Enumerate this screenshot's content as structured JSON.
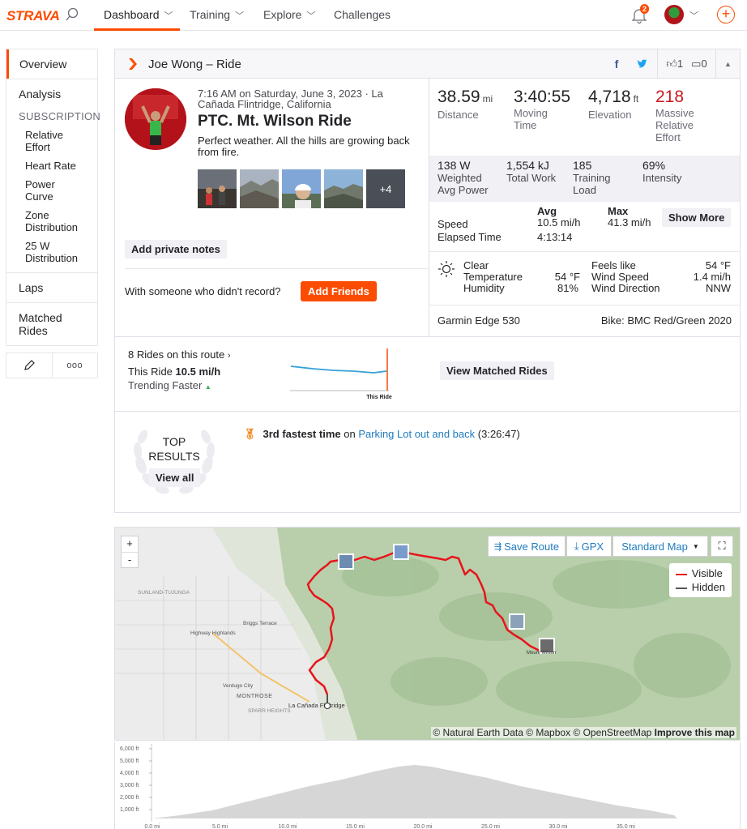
{
  "nav": {
    "logo": "STRAVA",
    "items": [
      {
        "label": "Dashboard"
      },
      {
        "label": "Training"
      },
      {
        "label": "Explore"
      },
      {
        "label": "Challenges"
      }
    ],
    "notification_count": "2",
    "accent": "#fc4c02"
  },
  "sidebar": {
    "overview": "Overview",
    "analysis": "Analysis",
    "subscription_head": "SUBSCRIPTION",
    "sub_items": [
      "Relative Effort",
      "Heart Rate",
      "Power Curve",
      "Zone Distribution",
      "25 W Distribution"
    ],
    "laps": "Laps",
    "matched_rides": "Matched Rides",
    "more_icon": "ooo"
  },
  "activity": {
    "header_title": "Joe Wong – Ride",
    "kudos_count": "1",
    "comment_count": "0",
    "date": "7:16 AM on Saturday, June 3, 2023 · La Cañada Flintridge, California",
    "title": "PTC. Mt. Wilson Ride",
    "description": "Perfect weather. All the hills are growing back from fire.",
    "more_photos": "+4",
    "add_private_notes": "Add private notes",
    "someone_prompt": "With someone who didn't record?",
    "add_friends": "Add Friends"
  },
  "stats": {
    "distance": {
      "value": "38.59",
      "unit": "mi",
      "label": "Distance"
    },
    "moving_time": {
      "value": "3:40:55",
      "label": "Moving Time"
    },
    "elevation": {
      "value": "4,718",
      "unit": "ft",
      "label": "Elevation"
    },
    "effort": {
      "value": "218",
      "label": "Massive Relative Effort"
    },
    "weighted_power": {
      "value": "138 W",
      "label": "Weighted Avg Power"
    },
    "total_work": {
      "value": "1,554 kJ",
      "label": "Total Work"
    },
    "training_load": {
      "value": "185",
      "label": "Training Load"
    },
    "intensity": {
      "value": "69%",
      "label": "Intensity"
    },
    "avg_head": "Avg",
    "max_head": "Max",
    "speed_label": "Speed",
    "speed_avg": "10.5 mi/h",
    "speed_max": "41.3 mi/h",
    "elapsed_label": "Elapsed Time",
    "elapsed_value": "4:13:14",
    "show_more": "Show More"
  },
  "weather": {
    "condition": "Clear",
    "temperature_label": "Temperature",
    "temperature": "54 °F",
    "humidity_label": "Humidity",
    "humidity": "81%",
    "feels_like_label": "Feels like",
    "feels_like": "54 °F",
    "wind_speed_label": "Wind Speed",
    "wind_speed": "1.4 mi/h",
    "wind_direction_label": "Wind Direction",
    "wind_direction": "NNW"
  },
  "device": {
    "device": "Garmin Edge 530",
    "bike": "Bike: BMC Red/Green 2020"
  },
  "matched": {
    "rides_on_route": "8 Rides on this route",
    "this_ride_label": "This Ride",
    "this_ride_speed": "10.5 mi/h",
    "trending": "Trending Faster",
    "chart_label": "This Ride",
    "view_button": "View Matched Rides"
  },
  "results": {
    "top": "TOP",
    "results": "RESULTS",
    "view_all": "View all",
    "achievement_bold": "3rd fastest time",
    "achievement_on": "on",
    "segment": "Parking Lot out and back",
    "segment_time": "(3:26:47)"
  },
  "map": {
    "zoom_in": "+",
    "zoom_out": "-",
    "save_route": "Save Route",
    "gpx": "GPX",
    "map_style": "Standard Map",
    "legend_visible": "Visible",
    "legend_hidden": "Hidden",
    "route_color": "#e8141b",
    "places": [
      "Briggs Terrace",
      "Highway Highlands",
      "Verdugo City",
      "MONTROSE",
      "La Cañada Flintridge",
      "SUNLAND-TUJUNGA",
      "TUJUNGA",
      "SPARR HEIGHTS",
      "Mount Wilson"
    ],
    "attribution_1": "© Natural Earth Data © Mapbox © OpenStreetMap",
    "attribution_2": "Improve this map"
  },
  "elevation": {
    "y_ticks": [
      "6,000 ft",
      "5,000 ft",
      "4,000 ft",
      "3,000 ft",
      "2,000 ft",
      "1,000 ft"
    ],
    "x_ticks": [
      "0.0 mi",
      "5.0 mi",
      "10.0 mi",
      "15.0 mi",
      "20.0 mi",
      "25.0 mi",
      "30.0 mi",
      "35.0 mi"
    ]
  }
}
